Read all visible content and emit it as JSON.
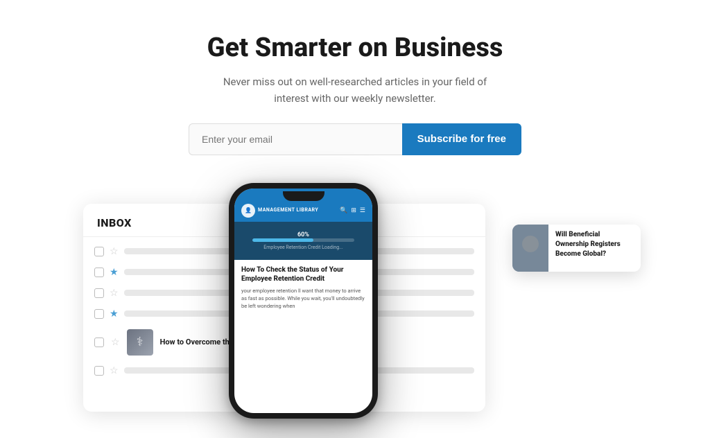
{
  "hero": {
    "title": "Get Smarter on Business",
    "subtitle": "Never miss out on well-researched articles in your field of interest with our weekly newsletter.",
    "email_placeholder": "Enter your email",
    "subscribe_label": "Subscribe for free"
  },
  "inbox": {
    "header": "INBOX",
    "rows": [
      {
        "starred": false
      },
      {
        "starred": true
      },
      {
        "starred": false
      },
      {
        "starred": true
      },
      {
        "starred": false,
        "has_image": true,
        "title": "How to Overcome the Damage: A Director Dilemma"
      },
      {
        "starred": false
      }
    ]
  },
  "phone": {
    "logo_text": "MANAGEMENT\nLIBRARY",
    "loading_percent": "60%",
    "loading_caption": "Employee Retention Credit Loading...",
    "article_title": "How To Check the Status of Your Employee Retention Credit",
    "article_body": "your employee retention ll want that money to arrive as fast as possible. While you wait, you'll undoubtedly be left wondering when"
  },
  "popup": {
    "title": "Will Beneficial Ownership Registers Become Global?"
  }
}
